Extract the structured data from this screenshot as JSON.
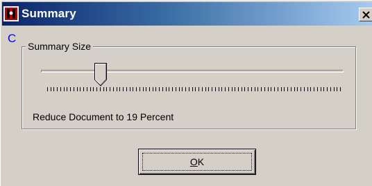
{
  "window": {
    "title": "Summary",
    "corner_mark": "C"
  },
  "group": {
    "label": "Summary Size"
  },
  "slider": {
    "value_percent": 19,
    "tick_count": 90
  },
  "status": {
    "text": "Reduce Document to 19 Percent"
  },
  "buttons": {
    "ok_accel": "O",
    "ok_rest": "K"
  },
  "icons": {
    "app": "app-icon",
    "close": "close-icon"
  },
  "colors": {
    "title_start": "#0a246a",
    "title_end": "#a6caf0",
    "face": "#d4d0c8",
    "mark": "#0000ff"
  }
}
